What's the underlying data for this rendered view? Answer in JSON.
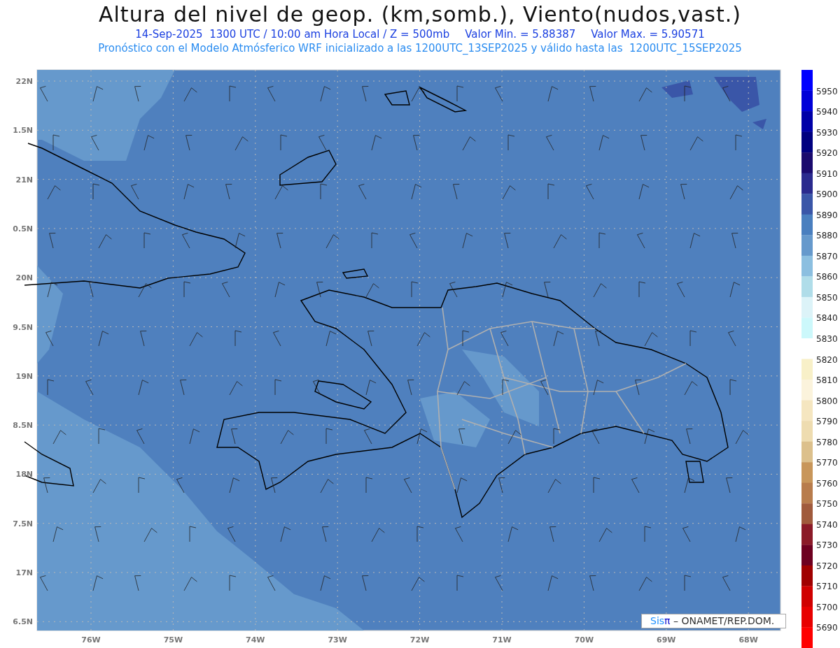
{
  "title": "Altura del nivel de geop. (km,somb.), Viento(nudos,vast.)",
  "subtitle": [
    "14-Sep-2025  1300 UTC / 10:00 am Hora Local / Z = 500mb",
    "Valor Min. = 5.88387",
    "Valor Max. = 5.90571"
  ],
  "note": "Pronóstico con el Modelo Atmósferico WRF inicializado a las 1200UTC_13SEP2025 y válido hasta las  1200UTC_15SEP2025",
  "map": {
    "lat_labels": [
      "22N",
      "1.5N",
      "21N",
      "0.5N",
      "20N",
      "9.5N",
      "19N",
      "8.5N",
      "18N",
      "7.5N",
      "17N",
      "6.5N"
    ],
    "lon_labels": [
      "76W",
      "75W",
      "74W",
      "73W",
      "72W",
      "71W",
      "70W",
      "69W",
      "68W"
    ],
    "credit": {
      "brand": "Sis",
      "symbol": "π",
      "text": "– ONAMET/REP.DOM."
    }
  },
  "colorbar": {
    "levels": [
      {
        "color": "#0000ff",
        "label": "5950"
      },
      {
        "color": "#0000d8",
        "label": "5940"
      },
      {
        "color": "#0000a8",
        "label": "5930"
      },
      {
        "color": "#000080",
        "label": "5920"
      },
      {
        "color": "#1a0a6e",
        "label": "5910"
      },
      {
        "color": "#2a2a8e",
        "label": "5900"
      },
      {
        "color": "#3a56a8",
        "label": "5890"
      },
      {
        "color": "#4a7fbf",
        "label": "5880"
      },
      {
        "color": "#6699cc",
        "label": "5870"
      },
      {
        "color": "#8cbfe0",
        "label": "5860"
      },
      {
        "color": "#b0dde9",
        "label": "5850"
      },
      {
        "color": "#dcf3f8",
        "label": "5840"
      },
      {
        "color": "#ccf8fb",
        "label": "5830"
      },
      {
        "color": "#ffffff",
        "label": "5820"
      },
      {
        "color": "#f8f0c8",
        "label": "5810"
      },
      {
        "color": "#fbf3dc",
        "label": "5800"
      },
      {
        "color": "#f5e6c0",
        "label": "5790"
      },
      {
        "color": "#eedcb0",
        "label": "5780"
      },
      {
        "color": "#dcc08c",
        "label": "5770"
      },
      {
        "color": "#c8965a",
        "label": "5760"
      },
      {
        "color": "#b87c4c",
        "label": "5750"
      },
      {
        "color": "#a05a3c",
        "label": "5740"
      },
      {
        "color": "#8b1a28",
        "label": "5730"
      },
      {
        "color": "#6e0020",
        "label": "5720"
      },
      {
        "color": "#a00000",
        "label": "5710"
      },
      {
        "color": "#d00000",
        "label": "5700"
      },
      {
        "color": "#e80000",
        "label": "5690"
      },
      {
        "color": "#ff0000"
      }
    ]
  }
}
